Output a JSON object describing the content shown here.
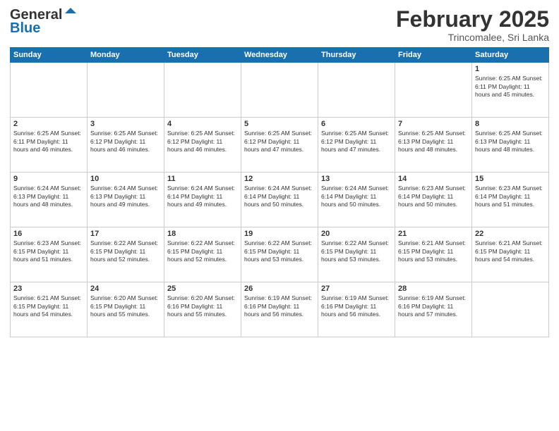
{
  "logo": {
    "line1": "General",
    "line2": "Blue"
  },
  "header": {
    "month": "February 2025",
    "location": "Trincomalee, Sri Lanka"
  },
  "weekdays": [
    "Sunday",
    "Monday",
    "Tuesday",
    "Wednesday",
    "Thursday",
    "Friday",
    "Saturday"
  ],
  "weeks": [
    [
      {
        "day": "",
        "info": ""
      },
      {
        "day": "",
        "info": ""
      },
      {
        "day": "",
        "info": ""
      },
      {
        "day": "",
        "info": ""
      },
      {
        "day": "",
        "info": ""
      },
      {
        "day": "",
        "info": ""
      },
      {
        "day": "1",
        "info": "Sunrise: 6:25 AM\nSunset: 6:11 PM\nDaylight: 11 hours\nand 45 minutes."
      }
    ],
    [
      {
        "day": "2",
        "info": "Sunrise: 6:25 AM\nSunset: 6:11 PM\nDaylight: 11 hours\nand 46 minutes."
      },
      {
        "day": "3",
        "info": "Sunrise: 6:25 AM\nSunset: 6:12 PM\nDaylight: 11 hours\nand 46 minutes."
      },
      {
        "day": "4",
        "info": "Sunrise: 6:25 AM\nSunset: 6:12 PM\nDaylight: 11 hours\nand 46 minutes."
      },
      {
        "day": "5",
        "info": "Sunrise: 6:25 AM\nSunset: 6:12 PM\nDaylight: 11 hours\nand 47 minutes."
      },
      {
        "day": "6",
        "info": "Sunrise: 6:25 AM\nSunset: 6:12 PM\nDaylight: 11 hours\nand 47 minutes."
      },
      {
        "day": "7",
        "info": "Sunrise: 6:25 AM\nSunset: 6:13 PM\nDaylight: 11 hours\nand 48 minutes."
      },
      {
        "day": "8",
        "info": "Sunrise: 6:25 AM\nSunset: 6:13 PM\nDaylight: 11 hours\nand 48 minutes."
      }
    ],
    [
      {
        "day": "9",
        "info": "Sunrise: 6:24 AM\nSunset: 6:13 PM\nDaylight: 11 hours\nand 48 minutes."
      },
      {
        "day": "10",
        "info": "Sunrise: 6:24 AM\nSunset: 6:13 PM\nDaylight: 11 hours\nand 49 minutes."
      },
      {
        "day": "11",
        "info": "Sunrise: 6:24 AM\nSunset: 6:14 PM\nDaylight: 11 hours\nand 49 minutes."
      },
      {
        "day": "12",
        "info": "Sunrise: 6:24 AM\nSunset: 6:14 PM\nDaylight: 11 hours\nand 50 minutes."
      },
      {
        "day": "13",
        "info": "Sunrise: 6:24 AM\nSunset: 6:14 PM\nDaylight: 11 hours\nand 50 minutes."
      },
      {
        "day": "14",
        "info": "Sunrise: 6:23 AM\nSunset: 6:14 PM\nDaylight: 11 hours\nand 50 minutes."
      },
      {
        "day": "15",
        "info": "Sunrise: 6:23 AM\nSunset: 6:14 PM\nDaylight: 11 hours\nand 51 minutes."
      }
    ],
    [
      {
        "day": "16",
        "info": "Sunrise: 6:23 AM\nSunset: 6:15 PM\nDaylight: 11 hours\nand 51 minutes."
      },
      {
        "day": "17",
        "info": "Sunrise: 6:22 AM\nSunset: 6:15 PM\nDaylight: 11 hours\nand 52 minutes."
      },
      {
        "day": "18",
        "info": "Sunrise: 6:22 AM\nSunset: 6:15 PM\nDaylight: 11 hours\nand 52 minutes."
      },
      {
        "day": "19",
        "info": "Sunrise: 6:22 AM\nSunset: 6:15 PM\nDaylight: 11 hours\nand 53 minutes."
      },
      {
        "day": "20",
        "info": "Sunrise: 6:22 AM\nSunset: 6:15 PM\nDaylight: 11 hours\nand 53 minutes."
      },
      {
        "day": "21",
        "info": "Sunrise: 6:21 AM\nSunset: 6:15 PM\nDaylight: 11 hours\nand 53 minutes."
      },
      {
        "day": "22",
        "info": "Sunrise: 6:21 AM\nSunset: 6:15 PM\nDaylight: 11 hours\nand 54 minutes."
      }
    ],
    [
      {
        "day": "23",
        "info": "Sunrise: 6:21 AM\nSunset: 6:15 PM\nDaylight: 11 hours\nand 54 minutes."
      },
      {
        "day": "24",
        "info": "Sunrise: 6:20 AM\nSunset: 6:15 PM\nDaylight: 11 hours\nand 55 minutes."
      },
      {
        "day": "25",
        "info": "Sunrise: 6:20 AM\nSunset: 6:16 PM\nDaylight: 11 hours\nand 55 minutes."
      },
      {
        "day": "26",
        "info": "Sunrise: 6:19 AM\nSunset: 6:16 PM\nDaylight: 11 hours\nand 56 minutes."
      },
      {
        "day": "27",
        "info": "Sunrise: 6:19 AM\nSunset: 6:16 PM\nDaylight: 11 hours\nand 56 minutes."
      },
      {
        "day": "28",
        "info": "Sunrise: 6:19 AM\nSunset: 6:16 PM\nDaylight: 11 hours\nand 57 minutes."
      },
      {
        "day": "",
        "info": ""
      }
    ]
  ]
}
